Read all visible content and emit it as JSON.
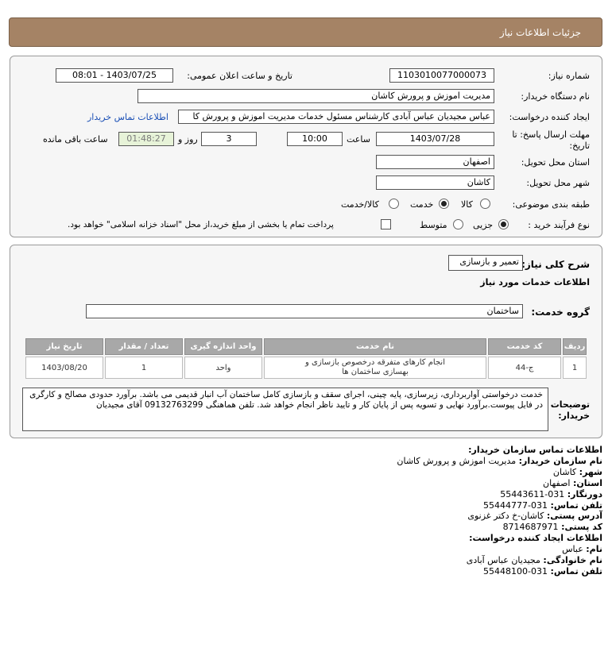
{
  "header": {
    "title": "جزئیات اطلاعات نیاز"
  },
  "form": {
    "need_number_label": "شماره نیاز:",
    "need_number": "1103010077000073",
    "announce_label": "تاریخ و ساعت اعلان عمومی:",
    "announce_value": "1403/07/25 - 08:01",
    "buyer_org_label": "نام دستگاه خریدار:",
    "buyer_org": "مدیریت اموزش و پرورش کاشان",
    "creator_label": "ایجاد کننده درخواست:",
    "creator": "عباس مجیدیان عباس آبادی کارشناس مسئول خدمات مدیریت اموزش و پرورش کا",
    "contact_link": "اطلاعات تماس خریدار",
    "deadline_label_1": "مهلت ارسال پاسخ: تا",
    "deadline_label_2": "تاریخ:",
    "deadline_date": "1403/07/28",
    "time_label": "ساعت",
    "deadline_time": "10:00",
    "days": "3",
    "days_label": "روز و",
    "remaining_time": "01:48:27",
    "remaining_label": "ساعت باقی مانده",
    "province_label": "استان محل تحویل:",
    "province": "اصفهان",
    "city_label": "شهر محل تحویل:",
    "city": "کاشان",
    "category_label": "طبقه بندی موضوعی:",
    "category_options": [
      "کالا",
      "خدمت",
      "کالا/خدمت"
    ],
    "category_selected": "خدمت",
    "process_label": "نوع فرآیند خرید :",
    "process_options": [
      "جزیی",
      "متوسط"
    ],
    "process_selected": "جزیی",
    "payment_note": "پرداخت تمام یا بخشی از مبلغ خرید،از محل \"اسناد خزانه اسلامی\" خواهد بود."
  },
  "summary": {
    "general_desc_label": "شرح کلی نیاز:",
    "general_desc": "تعمیر و بازسازی",
    "services_heading": "اطلاعات خدمات مورد نیاز",
    "service_group_label": "گروه خدمت:",
    "service_group": "ساختمان"
  },
  "table": {
    "headers": [
      "ردیف",
      "کد خدمت",
      "نام خدمت",
      "واحد اندازه گیری",
      "تعداد / مقدار",
      "تاریخ نیاز"
    ],
    "rows": [
      [
        "1",
        "ج-44",
        "انجام کارهای متفرقه درخصوص بازسازی و بهسازی ساختمان ها",
        "واحد",
        "1",
        "1403/08/20"
      ]
    ]
  },
  "buyer_desc": {
    "label_1": "توضیحات",
    "label_2": "خریدار:",
    "text": "خدمت درخواستی آواربرداری، زیرسازی، پایه چینی، اجرای سقف و بازسازی کامل ساختمان آب انبار قدیمی می باشد. برآورد حدودی مصالح و کارگری در فایل پیوست.برآورد نهایی و تسویه پس از پایان کار و تایید ناظر انجام خواهد شد. تلفن هماهنگی 09132763299 آقای مجیدیان"
  },
  "contact": {
    "heading": "اطلاعات تماس سازمان خریدار:",
    "org_label": "نام سازمان خریدار:",
    "org": "مدیریت اموزش و پرورش کاشان",
    "city_label": "شهر:",
    "city": "کاشان",
    "province_label": "استان:",
    "province": "اصفهان",
    "fax_label": "دورنگار:",
    "fax": "031-55443611",
    "phone_label": "تلفن تماس:",
    "phone": "031-55444777",
    "address_label": "آدرس پستی:",
    "address": "کاشان-خ دکتر غزنوی",
    "postal_label": "کد پستی:",
    "postal": "8714687971",
    "creator_heading": "اطلاعات ایجاد کننده درخواست:",
    "name_label": "نام:",
    "name": "عباس",
    "family_label": "نام خانوادگی:",
    "family": "مجیدیان عباس آبادی",
    "creator_phone_label": "تلفن تماس:",
    "creator_phone": "031-55448100"
  }
}
